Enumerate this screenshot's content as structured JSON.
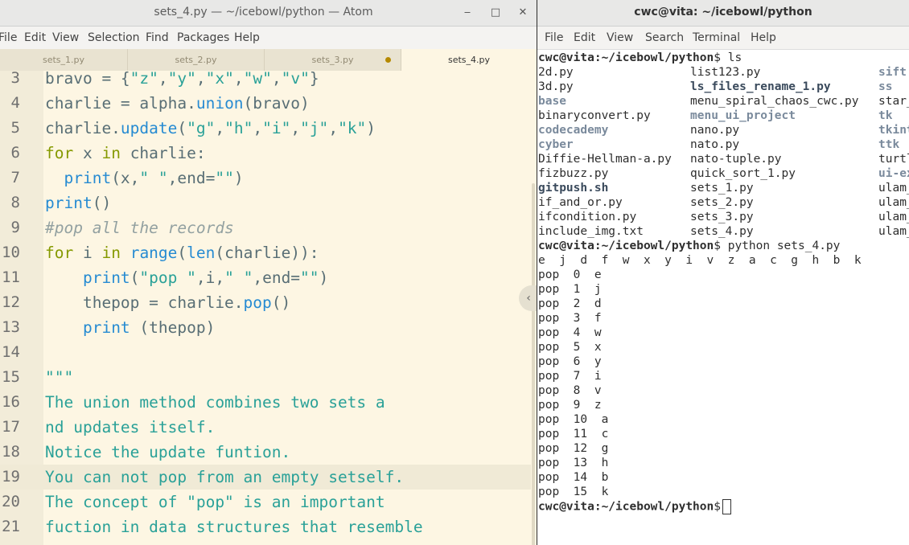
{
  "atom": {
    "title": "sets_4.py — ~/icebowl/python — Atom",
    "controls": {
      "minimize": "‒",
      "maximize": "□",
      "close": "✕"
    },
    "menu": [
      "File",
      "Edit",
      "View",
      "Selection",
      "Find",
      "Packages",
      "Help"
    ],
    "tabs": [
      "sets_1.py",
      "sets_2.py",
      "sets_3.py",
      "sets_4.py"
    ],
    "active_tab": "sets_4.py",
    "modified_tab": "sets_3.py",
    "line_numbers": [
      "3",
      "4",
      "5",
      "6",
      "7",
      "8",
      "9",
      "10",
      "11",
      "12",
      "13",
      "14",
      "15",
      "16",
      "17",
      "18",
      "19",
      "20",
      "21"
    ],
    "cursor_line": "19",
    "code": {
      "l3": [
        "bravo = {",
        "\"z\"",
        ",",
        "\"y\"",
        ",",
        "\"x\"",
        ",",
        "\"w\"",
        ",",
        "\"v\"",
        "}"
      ],
      "l4": [
        "charlie = alpha.",
        "union",
        "(bravo)"
      ],
      "l5": [
        "charlie.",
        "update",
        "(",
        "\"g\"",
        ",",
        "\"h\"",
        ",",
        "\"i\"",
        ",",
        "\"j\"",
        ",",
        "\"k\"",
        ")"
      ],
      "l6": [
        "for",
        " x ",
        "in",
        " charlie:"
      ],
      "l7": [
        "  ",
        "print",
        "(x,",
        "\" \"",
        ",end=",
        "\"\"",
        ")"
      ],
      "l8": [
        "print",
        "()"
      ],
      "l9": "#pop all the records",
      "l10": [
        "for",
        " i ",
        "in",
        " ",
        "range",
        "(",
        "len",
        "(charlie)):"
      ],
      "l11": [
        "    ",
        "print",
        "(",
        "\"pop \"",
        ",i,",
        "\" \"",
        ",end=",
        "\"\"",
        ")"
      ],
      "l12": [
        "    thepop = charlie.",
        "pop",
        "()"
      ],
      "l13": [
        "    ",
        "print",
        " (thepop)"
      ],
      "l14": "",
      "l15": "\"\"\"",
      "l16": "The union method combines two sets a",
      "l17": "nd updates itself.",
      "l18": "Notice the update funtion.",
      "l19": "You can not pop from an empty setself.",
      "l20": "The concept of \"pop\" is an important",
      "l21": "fuction in data structures that resemble"
    }
  },
  "terminal": {
    "title": "cwc@vita: ~/icebowl/python",
    "menu": [
      "File",
      "Edit",
      "View",
      "Search",
      "Terminal",
      "Help"
    ],
    "prompt": "cwc@vita:~/icebowl/python",
    "cmd1": "$ ls",
    "ls_rows": [
      [
        "2d.py",
        "list123.py",
        "sift"
      ],
      [
        "3d.py",
        "ls_files_rename_1.py",
        "ss"
      ],
      [
        "base",
        "menu_spiral_chaos_cwc.py",
        "star_"
      ],
      [
        "binaryconvert.py",
        "menu_ui_project",
        "tk"
      ],
      [
        "codecademy",
        "nano.py",
        "tkint"
      ],
      [
        "cyber",
        "nato.py",
        "ttk"
      ],
      [
        "Diffie-Hellman-a.py",
        "nato-tuple.py",
        "turtl"
      ],
      [
        "fizbuzz.py",
        "quick_sort_1.py",
        "ui-ex"
      ],
      [
        "gitpush.sh",
        "sets_1.py",
        "ulam_"
      ],
      [
        "if_and_or.py",
        "sets_2.py",
        "ulam_"
      ],
      [
        "ifcondition.py",
        "sets_3.py",
        "ulam_"
      ],
      [
        "include_img.txt",
        "sets_4.py",
        "ulam_"
      ]
    ],
    "ls_styles": [
      [
        "",
        "",
        "dir"
      ],
      [
        "",
        "exe",
        "dir"
      ],
      [
        "dir",
        "",
        ""
      ],
      [
        "",
        "dir",
        "dir"
      ],
      [
        "dir",
        "",
        "dir"
      ],
      [
        "dir",
        "",
        "dir"
      ],
      [
        "",
        "",
        ""
      ],
      [
        "",
        "",
        "dir"
      ],
      [
        "exe",
        "",
        ""
      ],
      [
        "",
        "",
        ""
      ],
      [
        "",
        "",
        ""
      ],
      [
        "",
        "",
        ""
      ]
    ],
    "cmd2": "$ python sets_4.py",
    "set_output": "e  j  d  f  w  x  y  i  v  z  a  c  g  h  b  k",
    "pops": [
      "pop  0  e",
      "pop  1  j",
      "pop  2  d",
      "pop  3  f",
      "pop  4  w",
      "pop  5  x",
      "pop  6  y",
      "pop  7  i",
      "pop  8  v",
      "pop  9  z",
      "pop  10  a",
      "pop  11  c",
      "pop  12  g",
      "pop  13  h",
      "pop  14  b",
      "pop  15  k"
    ],
    "cmd3": "$"
  },
  "colors": {
    "editor_bg": "#fdf6e3",
    "keyword": "#859900",
    "function": "#268bd2",
    "string": "#2aa198",
    "comment": "#93a1a1"
  }
}
